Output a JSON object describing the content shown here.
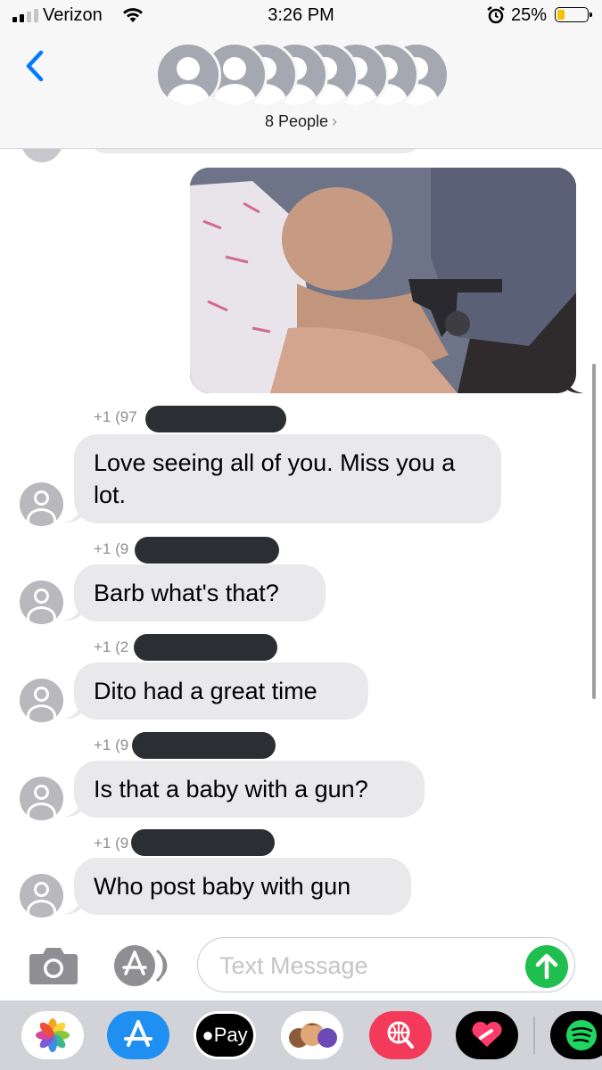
{
  "status_bar": {
    "carrier": "Verizon",
    "time": "3:26 PM",
    "battery": "25%",
    "battery_level": 0.25,
    "signal_bars": 2,
    "icons": [
      "signal-icon",
      "wifi-icon",
      "alarm-icon",
      "battery-icon"
    ]
  },
  "header": {
    "people_label": "8 People",
    "chevron": "›",
    "avatar_count": 8,
    "icons": [
      "back-chevron-icon",
      "person-icon"
    ]
  },
  "thread": {
    "sent_image": {
      "description_icon": "photo-attachment"
    },
    "messages": [
      {
        "sender": "+1 (97",
        "text": "Love seeing all of you. Miss you a lot."
      },
      {
        "sender": "+1 (9",
        "text": "Barb what's that?"
      },
      {
        "sender": "+1 (2",
        "text": "Dito had a great time"
      },
      {
        "sender": "+1 (9",
        "text": "Is that a baby with a gun?"
      },
      {
        "sender": "+1 (9",
        "text": "Who post baby with gun"
      }
    ]
  },
  "compose": {
    "placeholder": "Text Message",
    "icons": [
      "camera-icon",
      "app-store-icon",
      "send-arrow-icon"
    ]
  },
  "app_drawer": {
    "pay_label": "Pay",
    "apps": [
      "photos-icon",
      "app-store-icon",
      "apple-pay-icon",
      "memoji-icon",
      "web-search-icon",
      "digital-touch-icon",
      "spotify-icon"
    ]
  },
  "colors": {
    "accent": "#007aff",
    "bubble_received": "#e9e9eb",
    "send_button": "#1fbf4f",
    "redaction": "#2b2e33"
  }
}
